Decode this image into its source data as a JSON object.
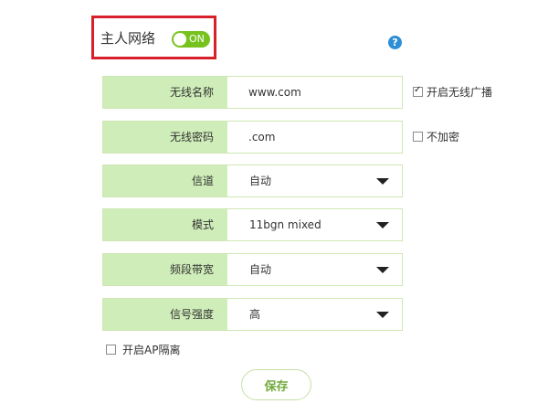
{
  "master": {
    "label": "主人网络",
    "toggle_text": "ON",
    "toggle_on": true,
    "toggle_color": "#78c21d",
    "highlight_color": "#d8202a"
  },
  "help_icon": {
    "name": "help-icon",
    "glyph": "?"
  },
  "form": {
    "ssid": {
      "label": "无线名称",
      "value": "www.com"
    },
    "password": {
      "label": "无线密码",
      "value": ".com"
    },
    "channel": {
      "label": "信道",
      "value": "自动"
    },
    "mode": {
      "label": "模式",
      "value": "11bgn mixed"
    },
    "bandwidth": {
      "label": "频段带宽",
      "value": "自动"
    },
    "signal": {
      "label": "信号强度",
      "value": "高"
    }
  },
  "options": {
    "broadcast": {
      "label": "开启无线广播",
      "checked": true
    },
    "no_encryption": {
      "label": "不加密",
      "checked": false
    },
    "ap_isolation": {
      "label": "开启AP隔离",
      "checked": false
    }
  },
  "buttons": {
    "save_label": "保存"
  },
  "colors": {
    "label_bg": "#cfedb8",
    "row_border": "#cfe6b3",
    "save_text": "#72a93d",
    "help_blue": "#2e8ed6"
  }
}
